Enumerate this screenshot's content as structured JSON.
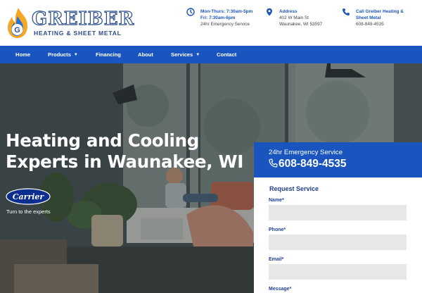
{
  "brand": {
    "name": "GREIBER",
    "tagline": "HEATING & SHEET METAL",
    "colors": {
      "primary": "#1a55bf",
      "dark_blue": "#1f3f8f",
      "flame": "#f5a623",
      "white": "#ffffff"
    }
  },
  "header": {
    "hours": {
      "icon": "clock-icon",
      "line1": "Mon-Thurs: 7:30am-5pm",
      "line2": "Fri: 7:30am-6pm",
      "line3": "24hr Emergency Service"
    },
    "address": {
      "icon": "map-pin-icon",
      "heading": "Address",
      "line1": "402 W Main St",
      "line2": "Waunakee, WI 53597"
    },
    "call": {
      "icon": "phone-icon",
      "heading": "Call Greiber Heating & Sheet Metal",
      "phone": "608-849-4535"
    }
  },
  "nav": {
    "items": [
      {
        "label": "Home"
      },
      {
        "label": "Products",
        "dropdown": true
      },
      {
        "label": "Financing"
      },
      {
        "label": "About"
      },
      {
        "label": "Services",
        "dropdown": true
      },
      {
        "label": "Contact"
      }
    ]
  },
  "hero": {
    "title_line1": "Heating and Cooling",
    "title_line2": "Experts in Waunakee, WI",
    "partner": {
      "name": "Carrier",
      "tagline": "Turn to the experts"
    }
  },
  "emergency": {
    "label": "24hr Emergency Service",
    "phone": "608-849-4535"
  },
  "form": {
    "title": "Request Service",
    "fields": [
      {
        "label": "Name*",
        "value": ""
      },
      {
        "label": "Phone*",
        "value": ""
      },
      {
        "label": "Email*",
        "value": ""
      },
      {
        "label": "Message*",
        "value": ""
      }
    ]
  }
}
